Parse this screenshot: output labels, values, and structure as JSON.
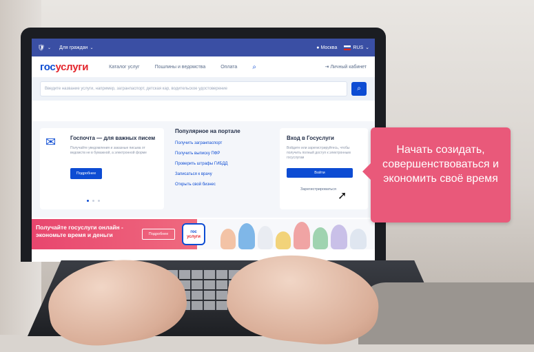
{
  "topbar": {
    "menu_label": "Для граждан",
    "location": "Москва",
    "language": "RUS"
  },
  "header": {
    "logo_part1": "гос",
    "logo_part2": "услуги",
    "nav": [
      "Каталог услуг",
      "Пошлины и ведомства",
      "Оплата"
    ],
    "cabinet": "Личный кабинет"
  },
  "search": {
    "placeholder": "Введите название услуги, например, загранпаспорт, детская кар, водительское удостоверение"
  },
  "promo_card": {
    "title": "Госпочта — для важных писем",
    "description": "Получайте уведомления и заказные письма от ведомств не в бумажной, а электронной форме",
    "button": "Подробнее"
  },
  "popular": {
    "title": "Популярное на портале",
    "links": [
      "Получить загранпаспорт",
      "Получить выписку ПФР",
      "Проверить штрафы ГИБДД",
      "Записаться к врачу",
      "Открыть свой бизнес"
    ]
  },
  "login_card": {
    "title": "Вход в Госуслуги",
    "description": "Войдите или зарегистрируйтесь, чтобы получить полный доступ к электронным госуслугам",
    "button": "Войти",
    "register": "Зарегистрироваться"
  },
  "banner": {
    "text": "Получайте госуслуги онлайн - экономьте время и деньги",
    "button": "Подробнее",
    "badge_part1": "гос",
    "badge_part2": "услуги"
  },
  "callout": {
    "text": "Начать созидать, совершенствоваться и экономить своё время"
  },
  "colors": {
    "brand_blue": "#0d4cd3",
    "brand_red": "#e3242b",
    "callout_pink": "#e9597a"
  }
}
